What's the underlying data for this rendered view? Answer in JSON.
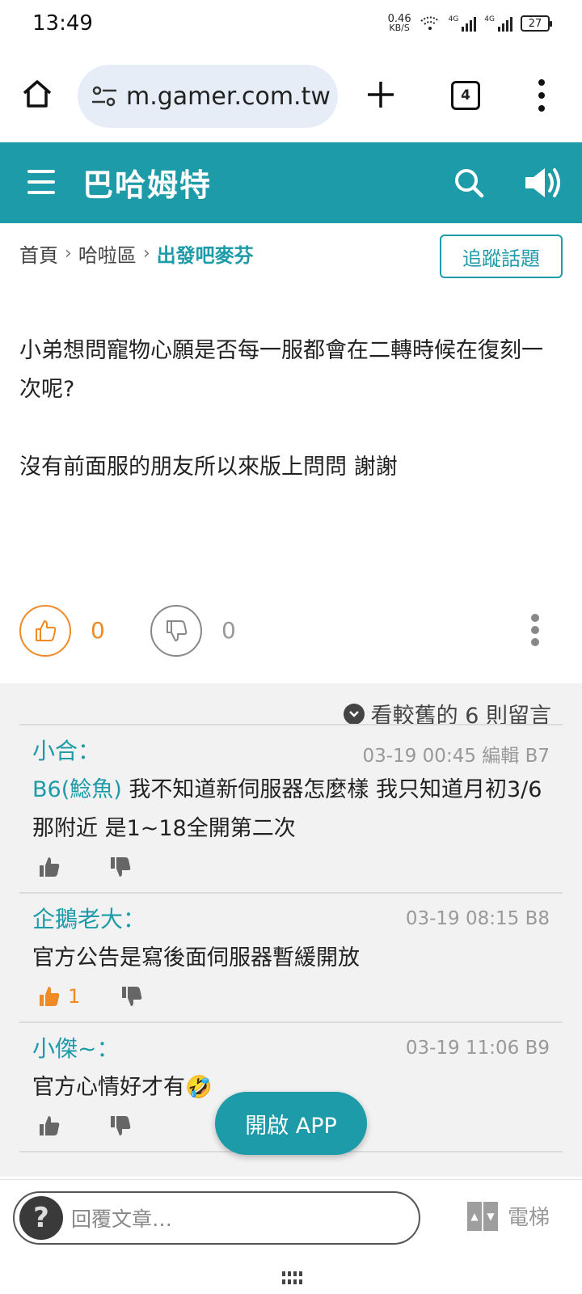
{
  "status_bar": {
    "time": "13:49",
    "net_speed_value": "0.46",
    "net_speed_unit": "KB/S",
    "signal1_label": "4G",
    "signal2_label": "4G",
    "battery": "27"
  },
  "browser": {
    "url": "m.gamer.com.tw",
    "tab_count": "4"
  },
  "site": {
    "title": "巴哈姆特",
    "brand_color": "#1d9ba8"
  },
  "breadcrumb": {
    "items": [
      "首頁",
      "哈啦區",
      "出發吧麥芬"
    ],
    "follow_label": "追蹤話題"
  },
  "article": {
    "paragraphs": [
      "小弟想問寵物心願是否每一服都會在二轉時候在復刻一次呢?",
      "沒有前面服的朋友所以來版上問問 謝謝"
    ],
    "likes": "0",
    "dislikes": "0"
  },
  "comments": {
    "older_label": "看較舊的 6 則留言",
    "items": [
      {
        "author": "小合：",
        "meta": "03-19 00:45 編輯  B7",
        "mention": "B6(鯰魚)",
        "text": " 我不知道新伺服器怎麼樣 我只知道月初3/6那附近 是1~18全開第二次",
        "likes": ""
      },
      {
        "author": "企鵝老大：",
        "meta": "03-19 08:15  B8",
        "mention": "",
        "text": "官方公告是寫後面伺服器暫緩開放",
        "likes": "1"
      },
      {
        "author": "小傑~：",
        "meta": "03-19 11:06  B9",
        "mention": "",
        "text": "官方心情好才有🤣",
        "likes": ""
      }
    ]
  },
  "open_app_label": "開啟 APP",
  "reply": {
    "placeholder": "回覆文章…",
    "elevator_label": "電梯"
  }
}
